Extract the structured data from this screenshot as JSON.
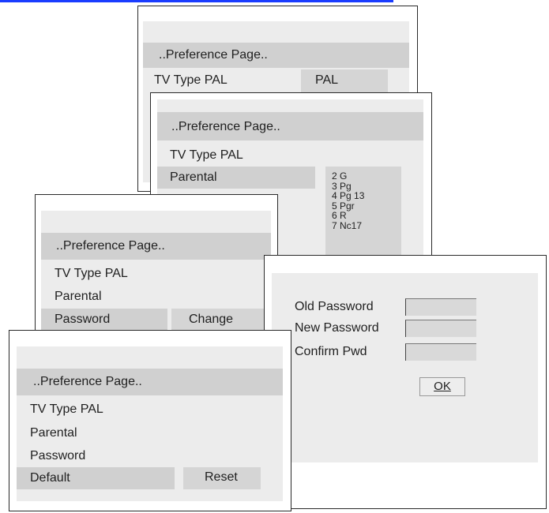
{
  "menu": {
    "title": "..Preference Page..",
    "tv_type": "TV Type   PAL",
    "tv_type_option": "PAL",
    "parental": "Parental",
    "password": "Password",
    "password_action": "Change",
    "default": "Default",
    "default_action": "Reset"
  },
  "parental_options": [
    "2 G",
    "3 Pg",
    "4 Pg 13",
    "5 Pgr",
    "6 R",
    "7 Nc17"
  ],
  "password_dialog": {
    "old_label": "Old Password",
    "new_label": "New Password",
    "confirm_label": "Confirm Pwd",
    "ok_label": "OK"
  }
}
